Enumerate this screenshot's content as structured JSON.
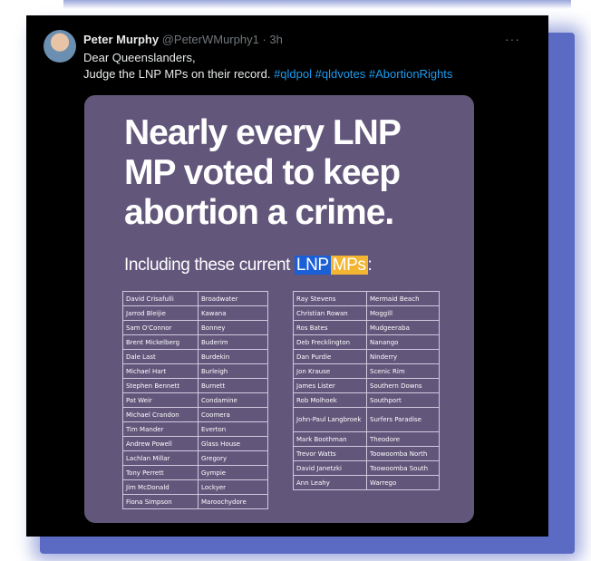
{
  "tweet": {
    "author_name": "Peter Murphy",
    "handle": "@PeterWMurphy1",
    "time": "· 3h",
    "more_icon": "···",
    "line1": "Dear Queenslanders,",
    "line2": "Judge the LNP MPs on their record.",
    "hashtags": [
      "#qldpol",
      "#qldvotes",
      "#AbortionRights"
    ]
  },
  "card": {
    "headline": "Nearly every LNP MP voted to keep abortion a crime.",
    "sub_prefix": "Including these current",
    "sub_lnp": "LNP",
    "sub_mps": "MPs",
    "sub_suffix": ":",
    "lnp_color": "#1a5fd6",
    "mps_color": "#f3b531"
  },
  "mps_left": [
    [
      "David Crisafulli",
      "Broadwater"
    ],
    [
      "Jarrod Bleijie",
      "Kawana"
    ],
    [
      "Sam O'Connor",
      "Bonney"
    ],
    [
      "Brent Mickelberg",
      "Buderim"
    ],
    [
      "Dale Last",
      "Burdekin"
    ],
    [
      "Michael Hart",
      "Burleigh"
    ],
    [
      "Stephen Bennett",
      "Burnett"
    ],
    [
      "Pat Weir",
      "Condamine"
    ],
    [
      "Michael Crandon",
      "Coomera"
    ],
    [
      "Tim Mander",
      "Everton"
    ],
    [
      "Andrew Powell",
      "Glass House"
    ],
    [
      "Lachlan Millar",
      "Gregory"
    ],
    [
      "Tony Perrett",
      "Gympie"
    ],
    [
      "Jim McDonald",
      "Lockyer"
    ],
    [
      "Fiona Simpson",
      "Maroochydore"
    ]
  ],
  "mps_right": [
    [
      "Ray Stevens",
      "Mermaid Beach"
    ],
    [
      "Christian Rowan",
      "Moggill"
    ],
    [
      "Ros Bates",
      "Mudgeeraba"
    ],
    [
      "Deb Frecklington",
      "Nanango"
    ],
    [
      "Dan Purdie",
      "Ninderry"
    ],
    [
      "Jon Krause",
      "Scenic Rim"
    ],
    [
      "James Lister",
      "Southern Downs"
    ],
    [
      "Rob Molhoek",
      "Southport"
    ],
    [
      "John-Paul Langbroek",
      "Surfers Paradise"
    ],
    [
      "Mark Boothman",
      "Theodore"
    ],
    [
      "Trevor Watts",
      "Toowoomba North"
    ],
    [
      "David Janetzki",
      "Toowoomba South"
    ],
    [
      "Ann Leahy",
      "Warrego"
    ]
  ]
}
